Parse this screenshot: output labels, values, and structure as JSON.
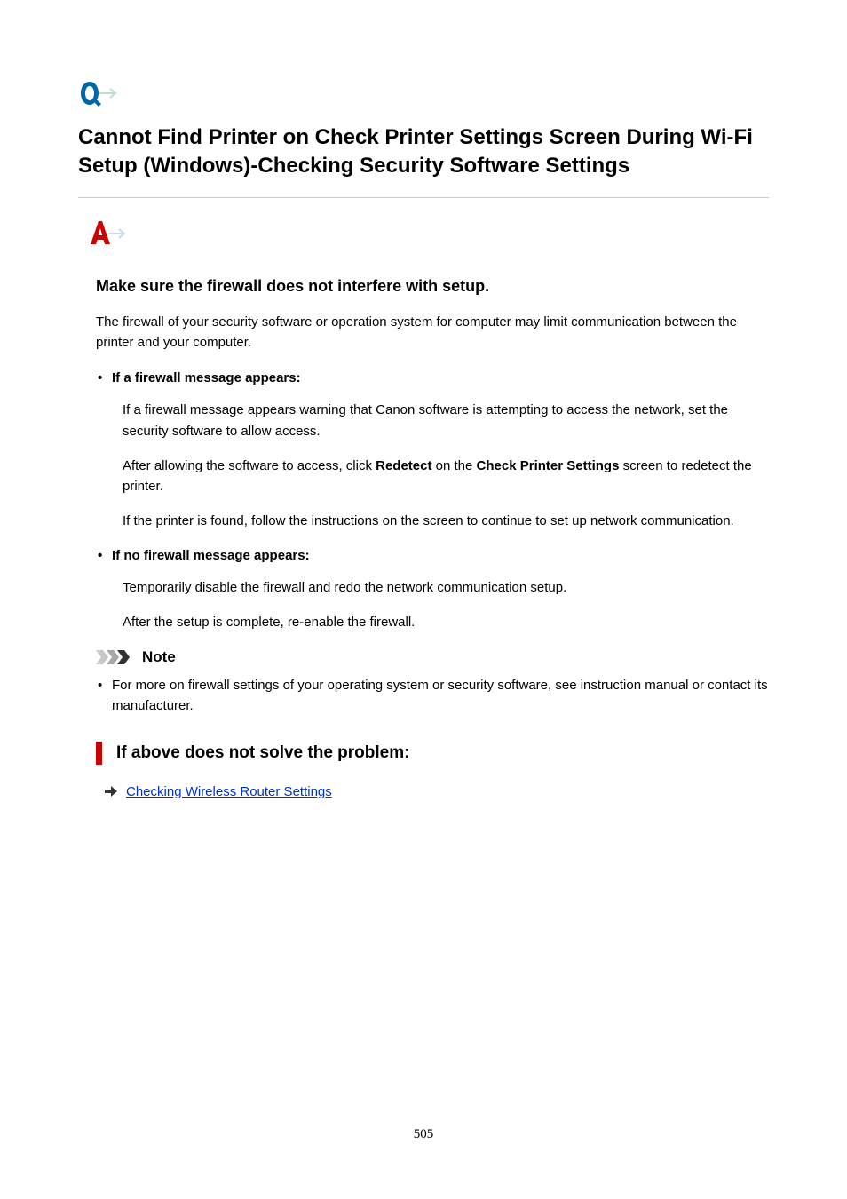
{
  "title": "Cannot Find Printer on Check Printer Settings Screen During Wi-Fi Setup (Windows)-Checking Security Software Settings",
  "section_heading": "Make sure the firewall does not interfere with setup.",
  "intro_paragraph": "The firewall of your security software or operation system for computer may limit communication between the printer and your computer.",
  "bullets": {
    "b1": {
      "title": "If a firewall message appears:",
      "p1": "If a firewall message appears warning that Canon software is attempting to access the network, set the security software to allow access.",
      "p2_pre": "After allowing the software to access, click ",
      "p2_bold1": "Redetect",
      "p2_mid": " on the ",
      "p2_bold2": "Check Printer Settings",
      "p2_post": " screen to redetect the printer.",
      "p3": "If the printer is found, follow the instructions on the screen to continue to set up network communication."
    },
    "b2": {
      "title": "If no firewall message appears:",
      "p1": "Temporarily disable the firewall and redo the network communication setup.",
      "p2": "After the setup is complete, re-enable the firewall."
    }
  },
  "note": {
    "title": "Note",
    "text": "For more on firewall settings of your operating system or security software, see instruction manual or contact its manufacturer."
  },
  "unresolved": {
    "heading": "If above does not solve the problem:",
    "link_text": "Checking Wireless Router Settings"
  },
  "page_number": "505"
}
